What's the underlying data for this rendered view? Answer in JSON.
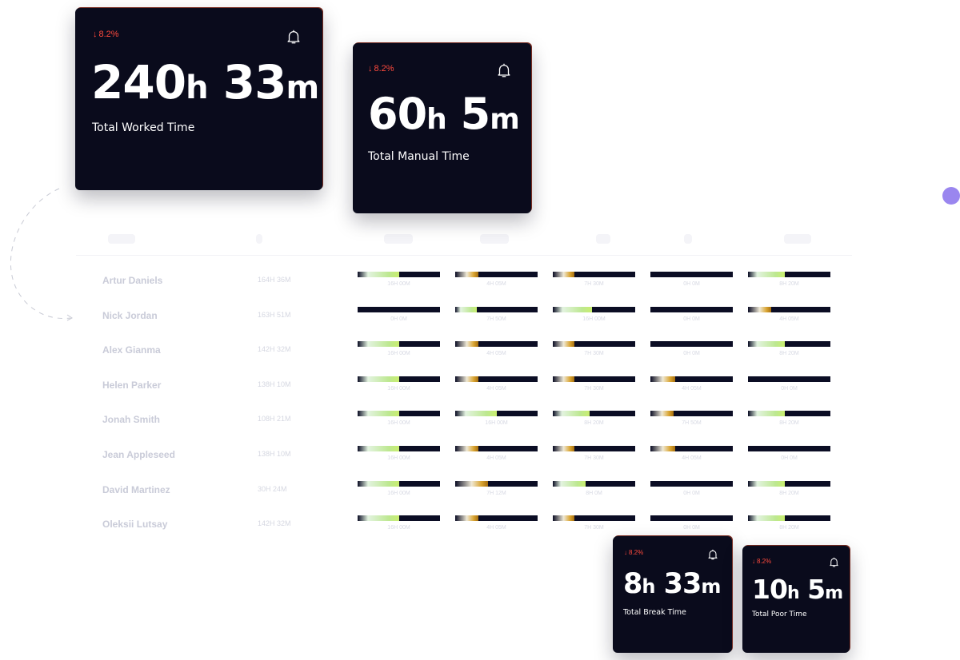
{
  "colors": {
    "card_bg": "#0a0b1c",
    "delta_red": "#ff4a3d",
    "accent_dot": "#9a86ef",
    "bar_track": "#0b0d24"
  },
  "cards": [
    {
      "delta": "8.2%",
      "value_h": "240",
      "unit_h": "h",
      "value_m": "33",
      "unit_m": "m",
      "label": "Total Worked Time",
      "icon": "bell-icon"
    },
    {
      "delta": "8.2%",
      "value_h": "60",
      "unit_h": "h",
      "value_m": "5",
      "unit_m": "m",
      "label": "Total Manual Time",
      "icon": "bell-icon"
    },
    {
      "delta": "8.2%",
      "value_h": "8",
      "unit_h": "h",
      "value_m": "33",
      "unit_m": "m",
      "label": "Total Break Time",
      "icon": "bell-icon"
    },
    {
      "delta": "8.2%",
      "value_h": "10",
      "unit_h": "h",
      "value_m": "5",
      "unit_m": "m",
      "label": "Total Poor Time",
      "icon": "bell-icon"
    }
  ],
  "rows": [
    {
      "name": "Artur Daniels",
      "total": "164H 36M",
      "cells": [
        {
          "label": "16H 00M",
          "fill": 0.5,
          "style": "green"
        },
        {
          "label": "4H 05M",
          "fill": 0.28,
          "style": "amber"
        },
        {
          "label": "7H 30M",
          "fill": 0.26,
          "style": "amber"
        },
        {
          "label": "0H 0M",
          "fill": 0,
          "style": "green"
        },
        {
          "label": "8H 20M",
          "fill": 0.45,
          "style": "green"
        }
      ]
    },
    {
      "name": "Nick Jordan",
      "total": "163H 51M",
      "cells": [
        {
          "label": "0H 0M",
          "fill": 0,
          "style": "green"
        },
        {
          "label": "7H 50M",
          "fill": 0.26,
          "style": "green"
        },
        {
          "label": "16H 00M",
          "fill": 0.48,
          "style": "green"
        },
        {
          "label": "0H 0M",
          "fill": 0,
          "style": "green"
        },
        {
          "label": "4H 05M",
          "fill": 0.28,
          "style": "amber"
        }
      ]
    },
    {
      "name": "Alex Gianma",
      "total": "142H 32M",
      "cells": [
        {
          "label": "16H 00M",
          "fill": 0.5,
          "style": "green"
        },
        {
          "label": "4H 05M",
          "fill": 0.28,
          "style": "amber"
        },
        {
          "label": "7H 30M",
          "fill": 0.26,
          "style": "amber"
        },
        {
          "label": "0H 0M",
          "fill": 0,
          "style": "green"
        },
        {
          "label": "8H 20M",
          "fill": 0.45,
          "style": "green"
        }
      ]
    },
    {
      "name": "Helen Parker",
      "total": "138H 10M",
      "cells": [
        {
          "label": "16H 00M",
          "fill": 0.5,
          "style": "green"
        },
        {
          "label": "4H 05M",
          "fill": 0.28,
          "style": "amber"
        },
        {
          "label": "7H 30M",
          "fill": 0.26,
          "style": "amber"
        },
        {
          "label": "4H 05M",
          "fill": 0.3,
          "style": "amber"
        },
        {
          "label": "0H 0M",
          "fill": 0,
          "style": "green"
        }
      ]
    },
    {
      "name": "Jonah Smith",
      "total": "108H 21M",
      "cells": [
        {
          "label": "16H 00M",
          "fill": 0.5,
          "style": "green"
        },
        {
          "label": "16H 00M",
          "fill": 0.5,
          "style": "green"
        },
        {
          "label": "8H 20M",
          "fill": 0.45,
          "style": "green"
        },
        {
          "label": "7H 50M",
          "fill": 0.28,
          "style": "amber"
        },
        {
          "label": "8H 20M",
          "fill": 0.45,
          "style": "green"
        }
      ]
    },
    {
      "name": "Jean Appleseed",
      "total": "138H 10M",
      "cells": [
        {
          "label": "16H 00M",
          "fill": 0.5,
          "style": "green"
        },
        {
          "label": "4H 05M",
          "fill": 0.28,
          "style": "amber"
        },
        {
          "label": "7H 30M",
          "fill": 0.26,
          "style": "amber"
        },
        {
          "label": "4H 05M",
          "fill": 0.3,
          "style": "amber"
        },
        {
          "label": "0H 0M",
          "fill": 0,
          "style": "green"
        }
      ]
    },
    {
      "name": "David Martinez",
      "total": "30H 24M",
      "cells": [
        {
          "label": "16H 00M",
          "fill": 0.5,
          "style": "green"
        },
        {
          "label": "7H 12M",
          "fill": 0.4,
          "style": "amber"
        },
        {
          "label": "8H 0M",
          "fill": 0.4,
          "style": "green"
        },
        {
          "label": "0H 0M",
          "fill": 0,
          "style": "green"
        },
        {
          "label": "8H 20M",
          "fill": 0.45,
          "style": "green"
        }
      ]
    },
    {
      "name": "Oleksii Lutsay",
      "total": "142H 32M",
      "cells": [
        {
          "label": "16H 00M",
          "fill": 0.5,
          "style": "green"
        },
        {
          "label": "4H 05M",
          "fill": 0.28,
          "style": "amber"
        },
        {
          "label": "7H 30M",
          "fill": 0.26,
          "style": "amber"
        },
        {
          "label": "0H 0M",
          "fill": 0,
          "style": "green"
        },
        {
          "label": "8H 20M",
          "fill": 0.45,
          "style": "green"
        }
      ]
    }
  ]
}
